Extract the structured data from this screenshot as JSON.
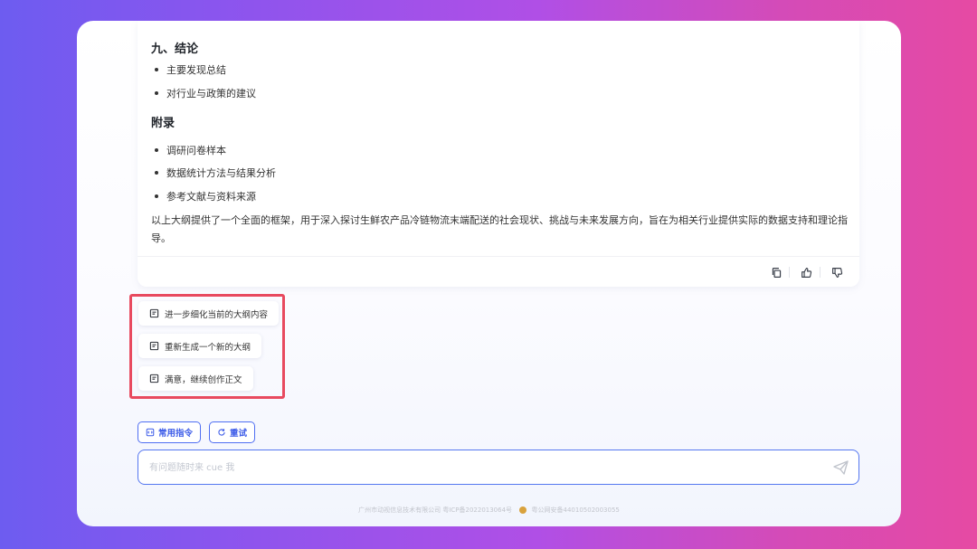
{
  "answer": {
    "sections": [
      {
        "heading": "九、结论",
        "items": [
          "主要发现总结",
          "对行业与政策的建议"
        ]
      },
      {
        "heading": "附录",
        "items": [
          "调研问卷样本",
          "数据统计方法与结果分析",
          "参考文献与资料来源"
        ]
      }
    ],
    "summary": "以上大纲提供了一个全面的框架，用于深入探讨生鲜农产品冷链物流末端配送的社会现状、挑战与未来发展方向，旨在为相关行业提供实际的数据支持和理论指导。"
  },
  "actions": {
    "copy_icon": "copy-icon",
    "like_icon": "thumbs-up-icon",
    "dislike_icon": "thumbs-down-icon"
  },
  "suggestions": [
    "进一步细化当前的大纲内容",
    "重新生成一个新的大纲",
    "满意，继续创作正文"
  ],
  "toolbar": {
    "commands_label": "常用指令",
    "retry_label": "重试"
  },
  "input": {
    "placeholder": "有问题随时来 cue 我"
  },
  "footer": {
    "company": "广州市动视信息技术有限公司 粤ICP备2022013064号",
    "record": "粤公网安备44010502003055"
  },
  "colors": {
    "accent": "#4f6ef2",
    "highlight_border": "#e84a5f"
  }
}
